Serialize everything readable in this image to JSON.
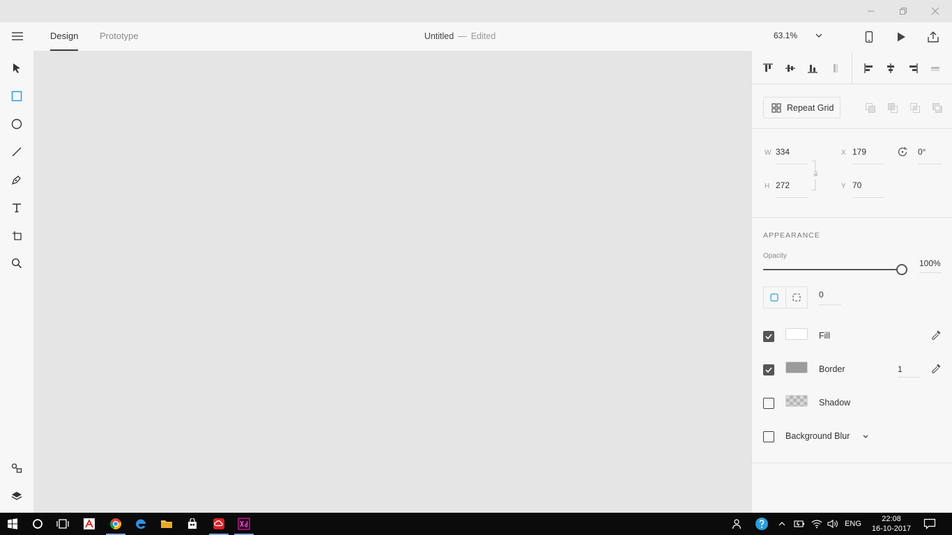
{
  "window": {
    "controls": [
      "minimize",
      "restore",
      "close"
    ]
  },
  "header": {
    "tabs": [
      {
        "label": "Design",
        "active": true
      },
      {
        "label": "Prototype",
        "active": false
      }
    ],
    "doc_title": "Untitled",
    "doc_separator": "—",
    "doc_status": "Edited",
    "zoom": "63.1%"
  },
  "toolbar": {
    "tools": [
      "select-icon",
      "rectangle-icon",
      "ellipse-icon",
      "line-icon",
      "pen-icon",
      "text-icon",
      "artboard-icon",
      "zoom-icon"
    ],
    "bottom": [
      "assets-icon",
      "layers-icon"
    ],
    "accent": "#2d9cdb"
  },
  "panel": {
    "repeat_grid_label": "Repeat Grid",
    "transform": {
      "w_label": "W",
      "w_value": "334",
      "h_label": "H",
      "h_value": "272",
      "x_label": "X",
      "x_value": "179",
      "y_label": "Y",
      "y_value": "70",
      "rotation_value": "0°"
    },
    "appearance": {
      "title": "APPEARANCE",
      "opacity_label": "Opacity",
      "opacity_value": "100%",
      "opacity_fraction": 1.0,
      "corner_radius": "0"
    },
    "properties": [
      {
        "label": "Fill",
        "checked": true,
        "swatch": "#ffffff"
      },
      {
        "label": "Border",
        "checked": true,
        "swatch": "#9b9b9b",
        "value": "1"
      },
      {
        "label": "Shadow",
        "checked": false,
        "swatch": "checker"
      },
      {
        "label": "Background Blur",
        "checked": false
      }
    ]
  },
  "taskbar": {
    "language": "ENG",
    "time": "22:08",
    "date": "16-10-2017"
  }
}
